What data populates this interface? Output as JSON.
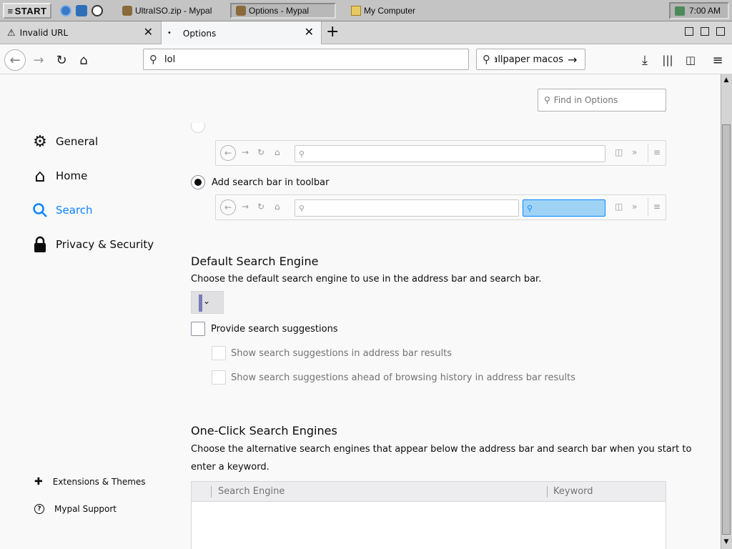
{
  "taskbar": {
    "start_label": "START",
    "tasks": [
      "UltraISO.zip - Mypal",
      "Options - Mypal",
      "My Computer"
    ],
    "clock": "7:00 AM"
  },
  "tabs": [
    {
      "label": "Invalid URL"
    },
    {
      "label": "Options"
    }
  ],
  "nav": {
    "url_value": "lol",
    "search_value": "wallpaper macos"
  },
  "find": {
    "placeholder": "Find in Options"
  },
  "categories": [
    {
      "label": "General"
    },
    {
      "label": "Home"
    },
    {
      "label": "Search"
    },
    {
      "label": "Privacy & Security"
    }
  ],
  "search_bar": {
    "add_toolbar_label": "Add search bar in toolbar"
  },
  "default_engine": {
    "title": "Default Search Engine",
    "description": "Choose the default search engine to use in the address bar and search bar.",
    "provide_suggestions": "Provide search suggestions",
    "suggest_address_bar": "Show search suggestions in address bar results",
    "suggest_ahead": "Show search suggestions ahead of browsing history in address bar results"
  },
  "one_click": {
    "title": "One-Click Search Engines",
    "description_line1": "Choose the alternative search engines that appear below the address bar and search bar when you start to",
    "description_line2": "enter a keyword.",
    "col_engine": "Search Engine",
    "col_keyword": "Keyword"
  },
  "footer": {
    "extensions": "Extensions & Themes",
    "support": "Mypal Support"
  },
  "colors": {
    "accent": "#0a84ff"
  }
}
